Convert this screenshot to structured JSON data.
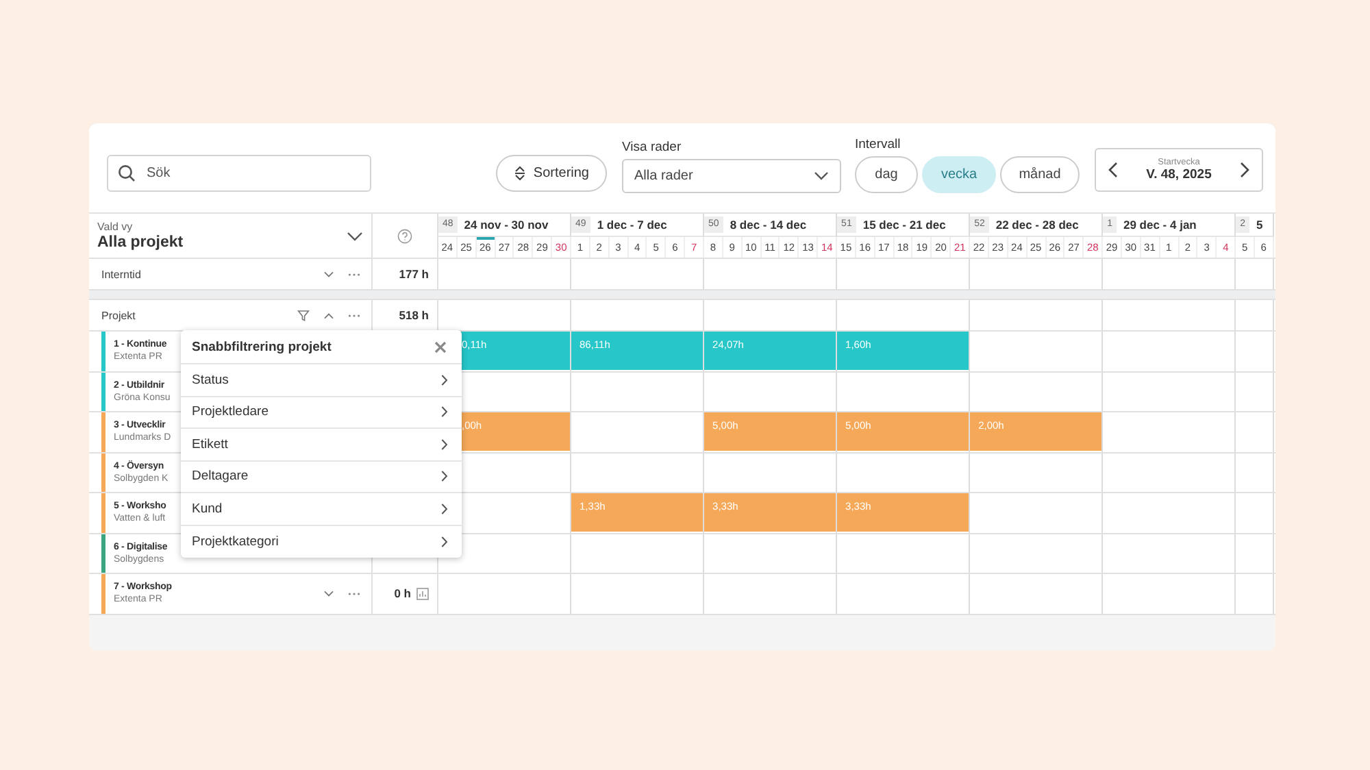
{
  "toolbar": {
    "search": {
      "placeholder": "Sök"
    },
    "sort_button": "Sortering",
    "rows_filter": {
      "label": "Visa rader",
      "value": "Alla rader"
    },
    "interval": {
      "label": "Intervall",
      "options": [
        {
          "label": "dag",
          "selected": false
        },
        {
          "label": "vecka",
          "selected": true
        },
        {
          "label": "månad",
          "selected": false
        }
      ]
    },
    "start_week": {
      "label": "Startvecka",
      "value": "V. 48, 2025"
    }
  },
  "view": {
    "label": "Vald vy",
    "value": "Alla projekt"
  },
  "weeks": [
    {
      "number": "48",
      "range": "24 nov - 30 nov",
      "days": [
        {
          "d": "24",
          "sunday": false,
          "today": false
        },
        {
          "d": "25",
          "sunday": false,
          "today": false
        },
        {
          "d": "26",
          "sunday": false,
          "today": true
        },
        {
          "d": "27",
          "sunday": false,
          "today": false
        },
        {
          "d": "28",
          "sunday": false,
          "today": false
        },
        {
          "d": "29",
          "sunday": false,
          "today": false
        },
        {
          "d": "30",
          "sunday": true,
          "today": false
        }
      ]
    },
    {
      "number": "49",
      "range": "1 dec - 7 dec",
      "days": [
        {
          "d": "1",
          "sunday": false,
          "today": false
        },
        {
          "d": "2",
          "sunday": false,
          "today": false
        },
        {
          "d": "3",
          "sunday": false,
          "today": false
        },
        {
          "d": "4",
          "sunday": false,
          "today": false
        },
        {
          "d": "5",
          "sunday": false,
          "today": false
        },
        {
          "d": "6",
          "sunday": false,
          "today": false
        },
        {
          "d": "7",
          "sunday": true,
          "today": false
        }
      ]
    },
    {
      "number": "50",
      "range": "8 dec - 14 dec",
      "days": [
        {
          "d": "8",
          "sunday": false,
          "today": false
        },
        {
          "d": "9",
          "sunday": false,
          "today": false
        },
        {
          "d": "10",
          "sunday": false,
          "today": false
        },
        {
          "d": "11",
          "sunday": false,
          "today": false
        },
        {
          "d": "12",
          "sunday": false,
          "today": false
        },
        {
          "d": "13",
          "sunday": false,
          "today": false
        },
        {
          "d": "14",
          "sunday": true,
          "today": false
        }
      ]
    },
    {
      "number": "51",
      "range": "15 dec - 21 dec",
      "days": [
        {
          "d": "15",
          "sunday": false,
          "today": false
        },
        {
          "d": "16",
          "sunday": false,
          "today": false
        },
        {
          "d": "17",
          "sunday": false,
          "today": false
        },
        {
          "d": "18",
          "sunday": false,
          "today": false
        },
        {
          "d": "19",
          "sunday": false,
          "today": false
        },
        {
          "d": "20",
          "sunday": false,
          "today": false
        },
        {
          "d": "21",
          "sunday": true,
          "today": false
        }
      ]
    },
    {
      "number": "52",
      "range": "22 dec - 28 dec",
      "days": [
        {
          "d": "22",
          "sunday": false,
          "today": false
        },
        {
          "d": "23",
          "sunday": false,
          "today": false
        },
        {
          "d": "24",
          "sunday": false,
          "today": false
        },
        {
          "d": "25",
          "sunday": false,
          "today": false
        },
        {
          "d": "26",
          "sunday": false,
          "today": false
        },
        {
          "d": "27",
          "sunday": false,
          "today": false
        },
        {
          "d": "28",
          "sunday": true,
          "today": false
        }
      ]
    },
    {
      "number": "1",
      "range": "29 dec - 4 jan",
      "days": [
        {
          "d": "29",
          "sunday": false,
          "today": false
        },
        {
          "d": "30",
          "sunday": false,
          "today": false
        },
        {
          "d": "31",
          "sunday": false,
          "today": false
        },
        {
          "d": "1",
          "sunday": false,
          "today": false
        },
        {
          "d": "2",
          "sunday": false,
          "today": false
        },
        {
          "d": "3",
          "sunday": false,
          "today": false
        },
        {
          "d": "4",
          "sunday": true,
          "today": false
        }
      ]
    },
    {
      "number": "2",
      "range": "5",
      "days": [
        {
          "d": "5",
          "sunday": false,
          "today": false
        },
        {
          "d": "6",
          "sunday": false,
          "today": false
        }
      ]
    }
  ],
  "groups": [
    {
      "name": "Interntid",
      "expanded": false,
      "hours": "177 h"
    },
    {
      "name": "Projekt",
      "expanded": true,
      "hours": "518 h"
    }
  ],
  "projects": [
    {
      "name": "1 - Kontinue",
      "client": "Extenta PR",
      "color": "#26c6c9",
      "cells": [
        {
          "filled": true,
          "label": "0,11h"
        },
        {
          "filled": true,
          "label": "86,11h"
        },
        {
          "filled": true,
          "label": "24,07h"
        },
        {
          "filled": true,
          "label": "1,60h"
        },
        {
          "filled": false
        },
        {
          "filled": false
        },
        {
          "filled": false
        }
      ]
    },
    {
      "name": "2 - Utbildnir",
      "client": "Gröna Konsu",
      "color": "#26c6c9",
      "cells": [
        {
          "filled": false
        },
        {
          "filled": false
        },
        {
          "filled": false
        },
        {
          "filled": false
        },
        {
          "filled": false
        },
        {
          "filled": false
        },
        {
          "filled": false
        }
      ]
    },
    {
      "name": "3 - Utvecklir",
      "client": "Lundmarks D",
      "color": "#f5a857",
      "cells": [
        {
          "filled": true,
          "label": ",00h"
        },
        {
          "filled": false
        },
        {
          "filled": true,
          "label": "5,00h"
        },
        {
          "filled": true,
          "label": "5,00h"
        },
        {
          "filled": true,
          "label": "2,00h"
        },
        {
          "filled": false
        },
        {
          "filled": false
        }
      ]
    },
    {
      "name": "4 - Översyn",
      "client": "Solbygden K",
      "color": "#f5a857",
      "cells": [
        {
          "filled": false
        },
        {
          "filled": false
        },
        {
          "filled": false
        },
        {
          "filled": false
        },
        {
          "filled": false
        },
        {
          "filled": false
        },
        {
          "filled": false
        }
      ]
    },
    {
      "name": "5 - Worksho",
      "client": "Vatten & luft",
      "color": "#f5a857",
      "cells": [
        {
          "filled": false
        },
        {
          "filled": true,
          "label": "1,33h"
        },
        {
          "filled": true,
          "label": "3,33h"
        },
        {
          "filled": true,
          "label": "3,33h"
        },
        {
          "filled": false
        },
        {
          "filled": false
        },
        {
          "filled": false
        }
      ]
    },
    {
      "name": "6 - Digitalise",
      "client": "Solbygdens",
      "color": "#3aa57f",
      "cells": [
        {
          "filled": false
        },
        {
          "filled": false
        },
        {
          "filled": false
        },
        {
          "filled": false
        },
        {
          "filled": false
        },
        {
          "filled": false
        },
        {
          "filled": false
        }
      ]
    },
    {
      "name": "7 - Workshop",
      "client": "Extenta PR",
      "color": "#f5a857",
      "hours": "0 h",
      "cells": [
        {
          "filled": false
        },
        {
          "filled": false
        },
        {
          "filled": false
        },
        {
          "filled": false
        },
        {
          "filled": false
        },
        {
          "filled": false
        },
        {
          "filled": false
        }
      ]
    }
  ],
  "quick_filter": {
    "title": "Snabbfiltrering projekt",
    "items": [
      "Status",
      "Projektledare",
      "Etikett",
      "Deltagare",
      "Kund",
      "Projektkategori"
    ]
  }
}
